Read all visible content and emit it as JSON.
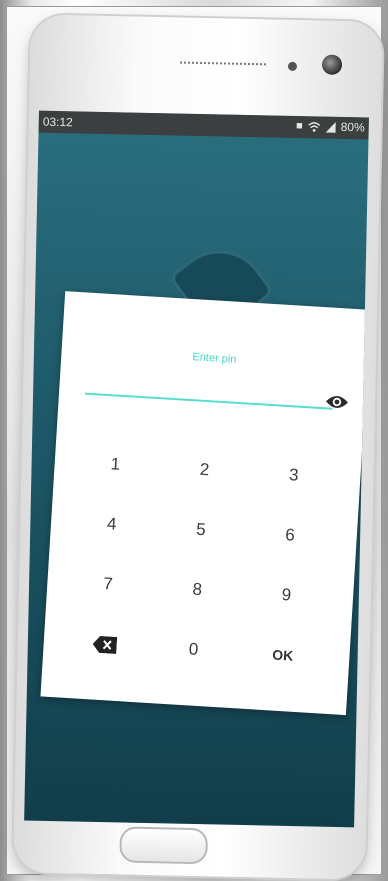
{
  "status_bar": {
    "time": "03:12",
    "battery": "80%"
  },
  "pin_dialog": {
    "title": "Enter pin",
    "keys": [
      {
        "label": "1"
      },
      {
        "label": "2"
      },
      {
        "label": "3"
      },
      {
        "label": "4"
      },
      {
        "label": "5"
      },
      {
        "label": "6"
      },
      {
        "label": "7"
      },
      {
        "label": "8"
      },
      {
        "label": "9"
      },
      {
        "label": "",
        "icon": "backspace-icon"
      },
      {
        "label": "0"
      },
      {
        "label": "OK"
      }
    ]
  },
  "colors": {
    "accent": "#47d6c4",
    "screen_bg": "#1f5a6a",
    "status_bar_bg": "#3c3f40"
  }
}
